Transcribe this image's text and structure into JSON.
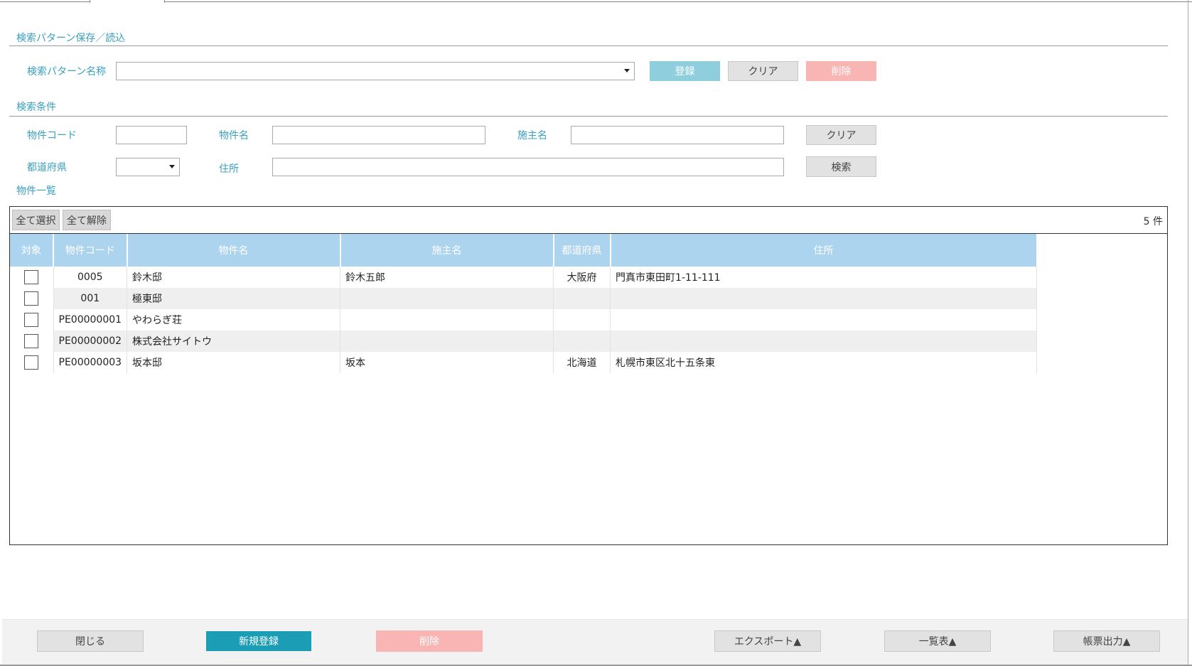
{
  "pattern_section": {
    "title": "検索パターン保存／読込",
    "name_label": "検索パターン名称",
    "name_value": "",
    "register_label": "登録",
    "clear_label": "クリア",
    "delete_label": "削除"
  },
  "search_section": {
    "title": "検索条件",
    "code_label": "物件コード",
    "code_value": "",
    "name_label": "物件名",
    "name_value": "",
    "owner_label": "施主名",
    "owner_value": "",
    "clear_label": "クリア",
    "pref_label": "都道府県",
    "pref_value": "",
    "address_label": "住所",
    "address_value": "",
    "search_label": "検索"
  },
  "list_section": {
    "title": "物件一覧",
    "select_all_label": "全て選択",
    "deselect_all_label": "全て解除",
    "count_text": "5 件",
    "columns": [
      "対象",
      "物件コード",
      "物件名",
      "施主名",
      "都道府県",
      "住所"
    ],
    "rows": [
      {
        "code": "0005",
        "name": "鈴木邸",
        "owner": "鈴木五郎",
        "pref": "大阪府",
        "address": "門真市東田町1-11-111",
        "checked": false
      },
      {
        "code": "001",
        "name": "極東邸",
        "owner": "",
        "pref": "",
        "address": "",
        "checked": false
      },
      {
        "code": "PE00000001",
        "name": "やわらぎ荘",
        "owner": "",
        "pref": "",
        "address": "",
        "checked": false
      },
      {
        "code": "PE00000002",
        "name": "株式会社サイトウ",
        "owner": "",
        "pref": "",
        "address": "",
        "checked": false
      },
      {
        "code": "PE00000003",
        "name": "坂本邸",
        "owner": "坂本",
        "pref": "北海道",
        "address": "札幌市東区北十五条東",
        "checked": false
      }
    ]
  },
  "footer": {
    "close_label": "閉じる",
    "new_label": "新規登録",
    "delete_label": "削除",
    "export_label": "エクスポート▲",
    "list_label": "一覧表▲",
    "report_label": "帳票出力▲"
  }
}
